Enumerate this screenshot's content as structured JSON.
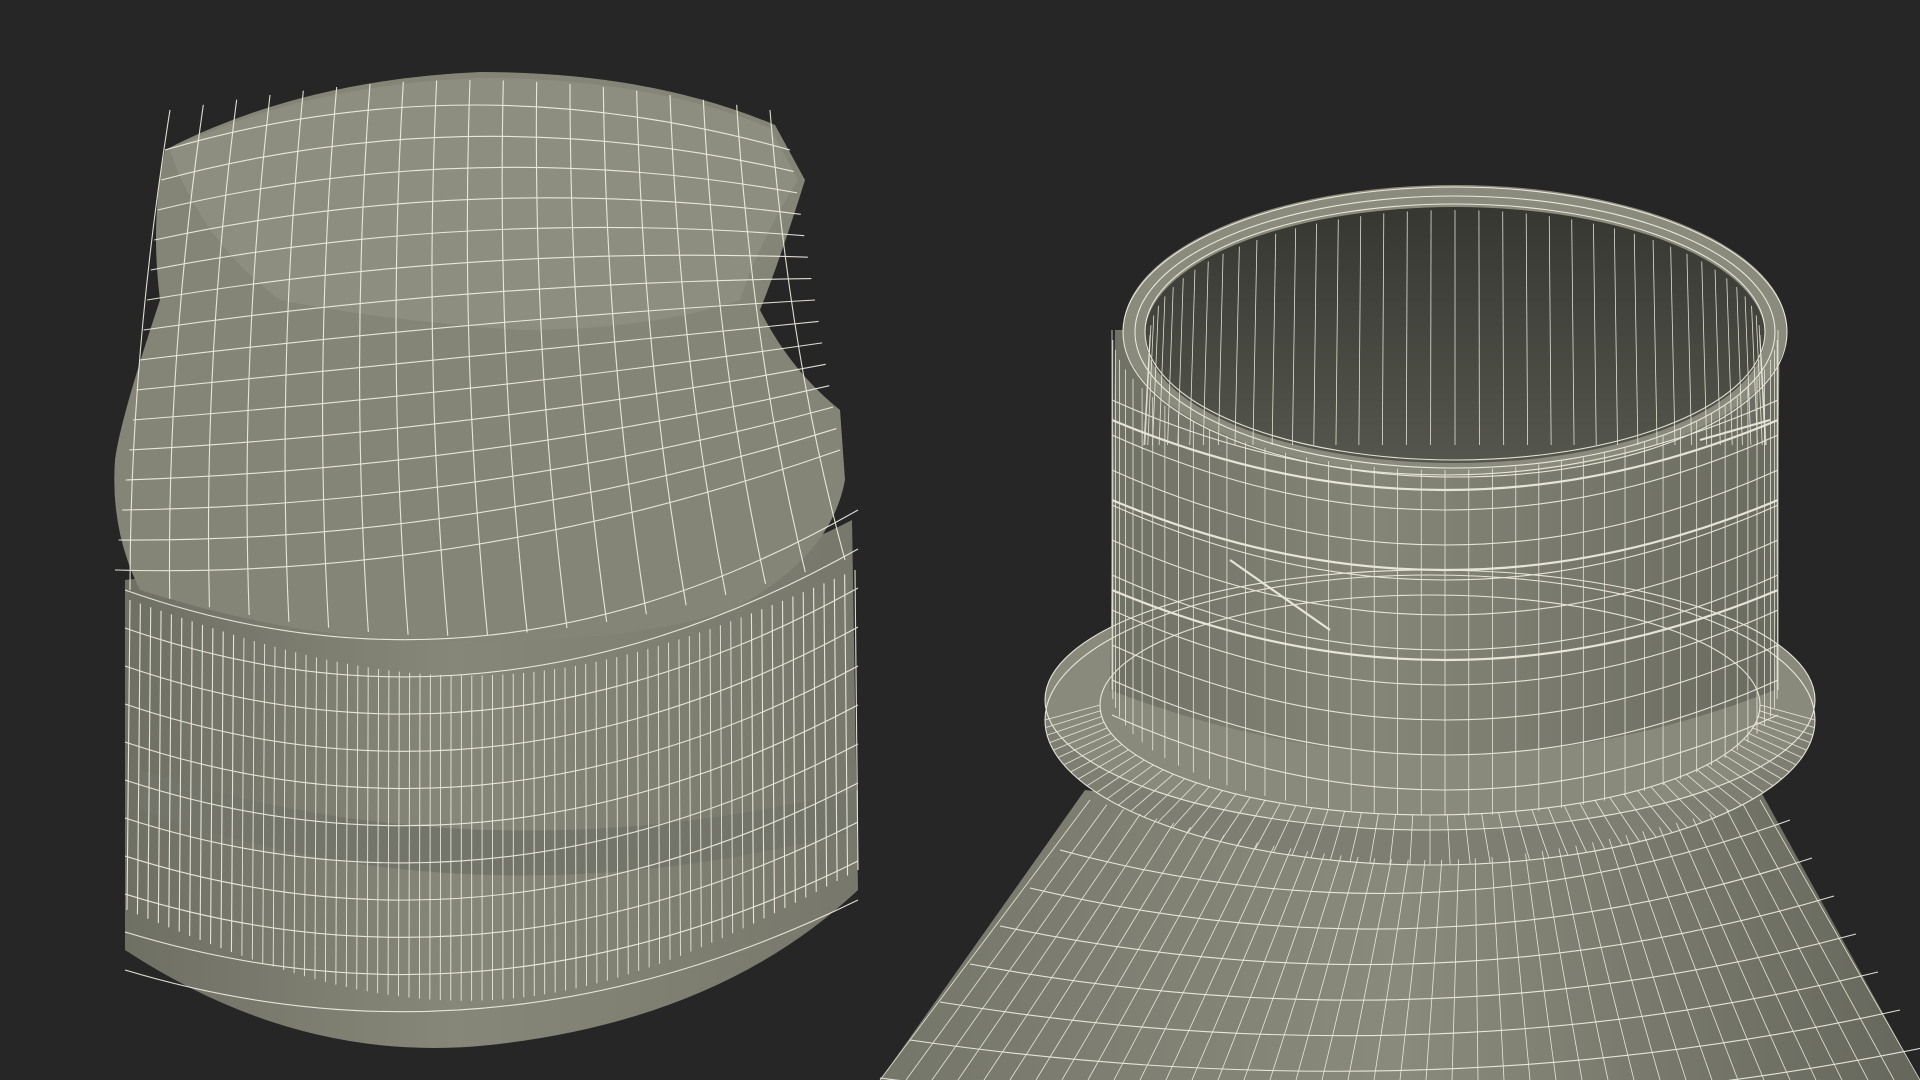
{
  "scene": {
    "background": "#262626",
    "surface_color": "#7c7c6f",
    "surface_shadow": "#5e5f55",
    "surface_light": "#8e8e80",
    "interior_color": "#3e3f38",
    "wire_color": "#f3f1e3",
    "objects": [
      {
        "name": "bottle-cap",
        "kind": "wireframe-mesh"
      },
      {
        "name": "bottle-neck",
        "kind": "wireframe-mesh"
      }
    ]
  }
}
